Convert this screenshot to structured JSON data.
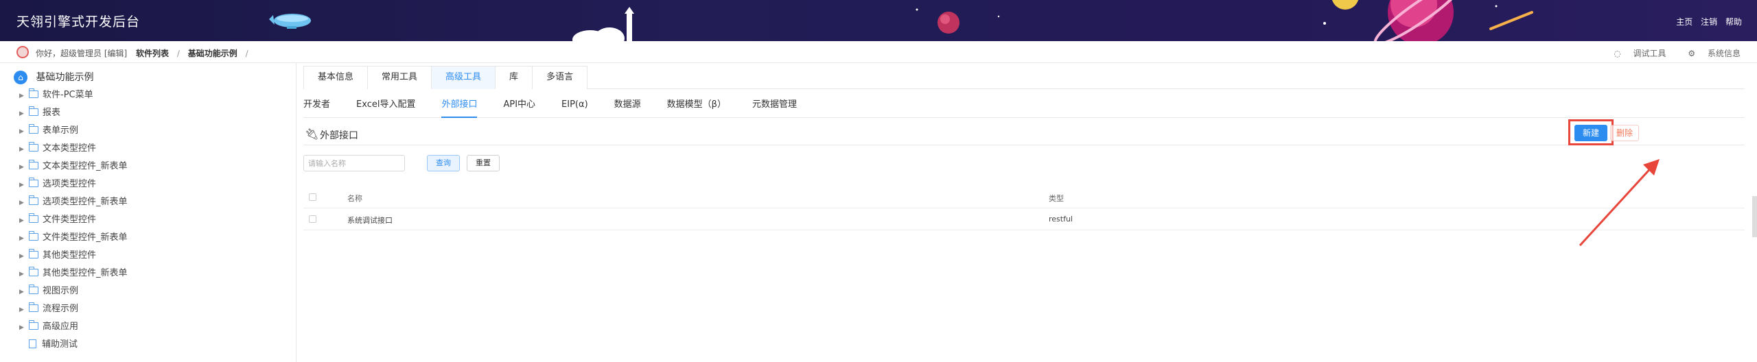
{
  "header": {
    "title": "天翎引擎式开发后台",
    "links": [
      "主页",
      "注销",
      "帮助"
    ]
  },
  "crumbbar": {
    "greeting": "你好，超级管理员 [编辑]",
    "crumb1": "软件列表",
    "crumb2": "基础功能示例",
    "sep": "/",
    "debug_tool": "调试工具",
    "system_info": "系统信息"
  },
  "sidebar": {
    "root": "基础功能示例",
    "items": [
      {
        "label": "软件-PC菜单",
        "type": "folder"
      },
      {
        "label": "报表",
        "type": "folder"
      },
      {
        "label": "表单示例",
        "type": "folder"
      },
      {
        "label": "文本类型控件",
        "type": "folder"
      },
      {
        "label": "文本类型控件_新表单",
        "type": "folder"
      },
      {
        "label": "选项类型控件",
        "type": "folder"
      },
      {
        "label": "选项类型控件_新表单",
        "type": "folder"
      },
      {
        "label": "文件类型控件",
        "type": "folder"
      },
      {
        "label": "文件类型控件_新表单",
        "type": "folder"
      },
      {
        "label": "其他类型控件",
        "type": "folder"
      },
      {
        "label": "其他类型控件_新表单",
        "type": "folder"
      },
      {
        "label": "视图示例",
        "type": "folder"
      },
      {
        "label": "流程示例",
        "type": "folder"
      },
      {
        "label": "高级应用",
        "type": "folder"
      },
      {
        "label": "辅助测试",
        "type": "file"
      }
    ]
  },
  "tabs_top": [
    "基本信息",
    "常用工具",
    "高级工具",
    "库",
    "多语言"
  ],
  "tabs_top_active": "高级工具",
  "tabs_sub": [
    "开发者",
    "Excel导入配置",
    "外部接口",
    "API中心",
    "EIP(α)",
    "数据源",
    "数据模型（β）",
    "元数据管理"
  ],
  "tabs_sub_active": "外部接口",
  "section": {
    "title": "外部接口",
    "new_label": "新建",
    "delete_label": "删除"
  },
  "search": {
    "placeholder": "请输入名称",
    "query_label": "查询",
    "reset_label": "重置"
  },
  "table": {
    "columns": [
      "名称",
      "类型"
    ],
    "rows": [
      {
        "name": "系统调试接口",
        "type": "restful"
      }
    ]
  },
  "colors": {
    "accent": "#2d8cf0",
    "header_bg": "#1f1a50",
    "highlight": "#e8463b"
  }
}
